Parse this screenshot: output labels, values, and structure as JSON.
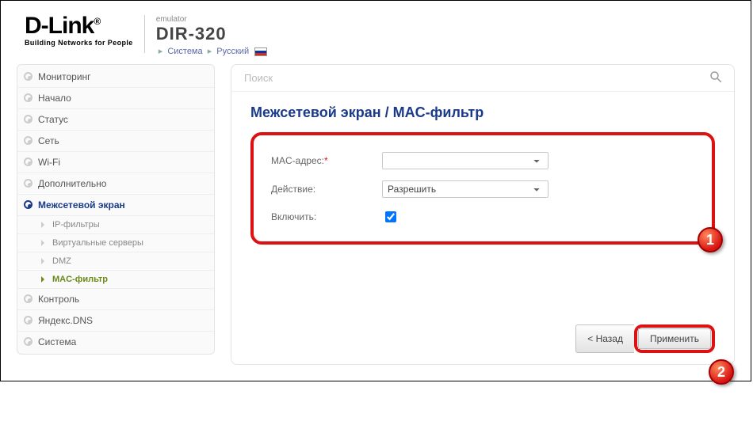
{
  "header": {
    "brand": "D-Link",
    "brand_reg": "®",
    "tagline": "Building Networks for People",
    "emulator": "emulator",
    "model": "DIR-320",
    "crumbs": {
      "system": "Система",
      "lang": "Русский"
    }
  },
  "sidebar": {
    "items": [
      {
        "label": "Мониторинг",
        "icon": "bullet"
      },
      {
        "label": "Начало",
        "icon": "bullet"
      },
      {
        "label": "Статус",
        "icon": "bullet"
      },
      {
        "label": "Сеть",
        "icon": "bullet"
      },
      {
        "label": "Wi-Fi",
        "icon": "bullet"
      },
      {
        "label": "Дополнительно",
        "icon": "bullet"
      },
      {
        "label": "Межсетевой экран",
        "icon": "bullet",
        "active": true
      },
      {
        "label": "Контроль",
        "icon": "bullet"
      },
      {
        "label": "Яндекс.DNS",
        "icon": "bullet"
      },
      {
        "label": "Система",
        "icon": "bullet"
      }
    ],
    "firewall_sub": [
      {
        "label": "IP-фильтры"
      },
      {
        "label": "Виртуальные серверы"
      },
      {
        "label": "DMZ"
      },
      {
        "label": "MAC-фильтр",
        "highlight": true
      }
    ]
  },
  "search": {
    "placeholder": "Поиск"
  },
  "content": {
    "breadcrumb_section": "Межсетевой экран",
    "breadcrumb_page": "MAC-фильтр",
    "form": {
      "mac_label": "MAC-адрес:",
      "mac_value": "",
      "action_label": "Действие:",
      "action_value": "Разрешить",
      "enable_label": "Включить:",
      "enable_checked": true
    }
  },
  "buttons": {
    "back": "< Назад",
    "apply": "Применить"
  },
  "callouts": {
    "c1": "1",
    "c2": "2"
  }
}
